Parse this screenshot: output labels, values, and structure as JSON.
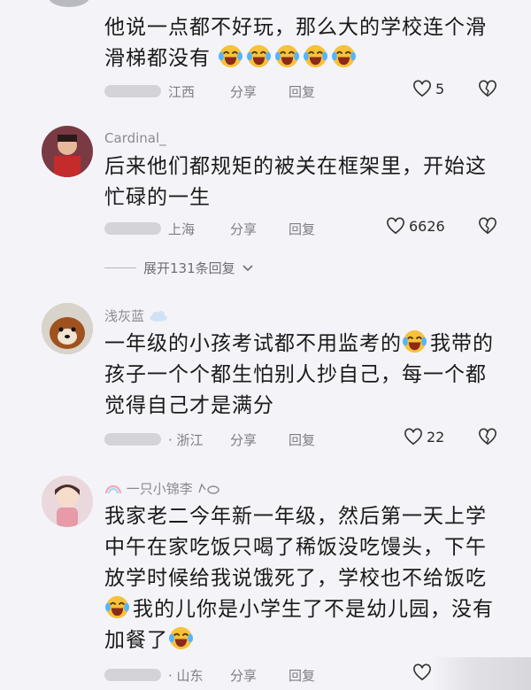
{
  "comments": [
    {
      "name": "",
      "lines": [
        "他说一点都不好玩，那么大的学校连个滑",
        "滑梯都没有"
      ],
      "meta": {
        "region": "江西",
        "share": "分享",
        "reply": "回复",
        "likes": "5"
      }
    },
    {
      "name": "Cardinal_",
      "lines": [
        "后来他们都规矩的被关在框架里，开始这",
        "忙碌的一生"
      ],
      "meta": {
        "region": "上海",
        "share": "分享",
        "reply": "回复",
        "likes": "6626"
      },
      "expand": "展开131条回复"
    },
    {
      "name": "浅灰蓝",
      "lines": [
        "一年级的小孩考试都不用监考的",
        "我带的",
        "孩子一个个都生怕别人抄自己，每一个都",
        "觉得自己才是满分"
      ],
      "meta": {
        "region": "· 浙江",
        "share": "分享",
        "reply": "回复",
        "likes": "22"
      }
    },
    {
      "name": "一只小锦李",
      "lines": [
        "我家老二今年新一年级，然后第一天上学",
        "中午在家吃饭只喝了稀饭没吃馒头，下午",
        "放学时候给我说饿死了，学校也不给饭吃",
        "我的儿你是小学生了不是幼儿园，没有",
        "加餐了"
      ],
      "meta": {
        "region": "· 山东",
        "share": "分享",
        "reply": "回复",
        "likes": ""
      }
    }
  ],
  "icons": {
    "like": "heart-outline-icon",
    "dislike": "broken-heart-icon",
    "expand": "chevron-down-icon",
    "emoji": "laughing-tears-emoji"
  },
  "colors": {
    "background": "#f4f4f8",
    "meta_text": "#7d7d82",
    "name_text": "#8a8a90",
    "emoji": "#f6c23a"
  }
}
